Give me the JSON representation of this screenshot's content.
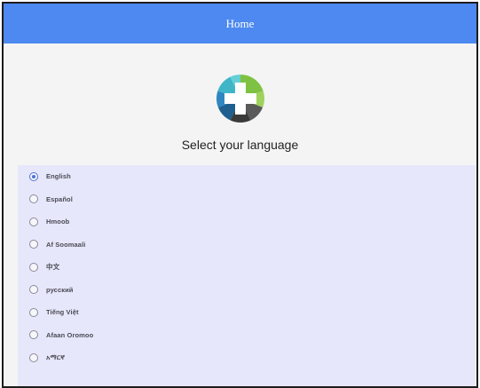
{
  "header": {
    "title": "Home"
  },
  "logo": {
    "icon": "cross-logo-icon"
  },
  "prompt": "Select your language",
  "languages": {
    "selected": "English",
    "items": [
      {
        "label": "English"
      },
      {
        "label": "Español"
      },
      {
        "label": "Hmoob"
      },
      {
        "label": "Af Soomaali"
      },
      {
        "label": "中文"
      },
      {
        "label": "русский"
      },
      {
        "label": "Tiếng Việt"
      },
      {
        "label": "Afaan Oromoo"
      },
      {
        "label": "አማርኛ"
      }
    ]
  },
  "colors": {
    "header": "#4d89f0",
    "list_background": "#e7e7fb",
    "accent": "#4d72d6"
  }
}
